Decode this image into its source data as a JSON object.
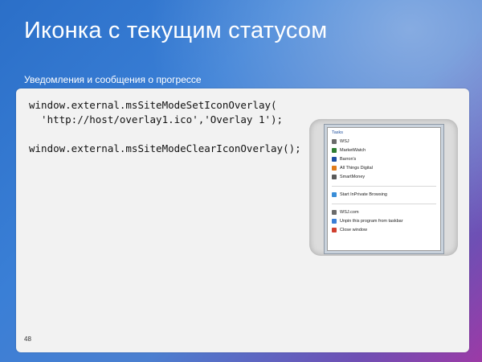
{
  "slide": {
    "title": "Иконка с текущим статусом",
    "subtitle": "Уведомления и сообщения о прогрессе",
    "page_number": "48"
  },
  "code": {
    "line1": "window.external.msSiteModeSetIconOverlay(",
    "line2": "  'http://host/overlay1.ico','Overlay 1');",
    "line3": "window.external.msSiteModeClearIconOverlay();"
  },
  "jumplist": {
    "header": "Tasks",
    "tasks": [
      {
        "label": "WSJ",
        "icon": "wsj-icon",
        "color": "#6b6b6b"
      },
      {
        "label": "MarketWatch",
        "icon": "marketwatch-icon",
        "color": "#2e7d32"
      },
      {
        "label": "Barron's",
        "icon": "barrons-icon",
        "color": "#1e4fa3"
      },
      {
        "label": "All Things Digital",
        "icon": "allthingsdigital-icon",
        "color": "#e07b1a"
      },
      {
        "label": "SmartMoney",
        "icon": "smartmoney-icon",
        "color": "#5a5a5a"
      }
    ],
    "inprivate": {
      "label": "Start InPrivate Browsing",
      "icon": "inprivate-icon",
      "color": "#3a8ed8"
    },
    "footer": [
      {
        "label": "WSJ.com",
        "icon": "wsj-site-icon",
        "color": "#6b6b6b"
      },
      {
        "label": "Unpin this program from taskbar",
        "icon": "unpin-icon",
        "color": "#3a7fd6"
      },
      {
        "label": "Close window",
        "icon": "close-window-icon",
        "color": "#d0402f"
      }
    ]
  }
}
